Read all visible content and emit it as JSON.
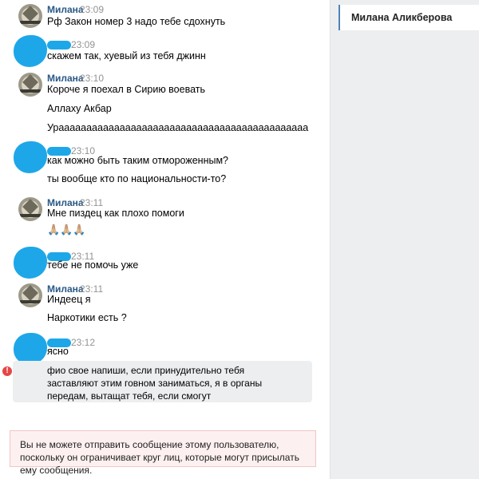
{
  "sidebar": {
    "conversation_name": "Милана Аликберова"
  },
  "messages": [
    {
      "sender": "Милана",
      "time": "23:09",
      "lines": [
        "Рф Закон номер 3 надо тебе сдохнуть"
      ]
    },
    {
      "sender": "",
      "time": "23:09",
      "lines": [
        "скажем так, хуевый из тебя джинн"
      ]
    },
    {
      "sender": "Милана",
      "time": "23:10",
      "lines": [
        "Короче я поехал в Сирию воевать",
        "Аллаху Акбар",
        "Урааааааааааааааааааааааааааааааааааааааааааааа"
      ]
    },
    {
      "sender": "",
      "time": "23:10",
      "lines": [
        "как можно быть таким отмороженным?",
        "ты вообще кто по национальности-то?"
      ]
    },
    {
      "sender": "Милана",
      "time": "23:11",
      "lines": [
        "Мне пиздец как плохо помоги",
        "🙏🏼🙏🏼🙏🏼"
      ]
    },
    {
      "sender": "",
      "time": "23:11",
      "lines": [
        "тебе не помочь уже"
      ]
    },
    {
      "sender": "Милана",
      "time": "23:11",
      "lines": [
        "Индеец я",
        "Наркотики есть ?"
      ]
    },
    {
      "sender": "",
      "time": "23:12",
      "lines": [
        "ясно"
      ]
    }
  ],
  "failed_message": {
    "icon": "!",
    "text": "фио свое напиши, если принудительно тебя заставляют этим говном заниматься, я в органы передам, вытащат тебя, если смогут"
  },
  "warning": "Вы не можете отправить сообщение этому пользователю, поскольку он ограничивает круг лиц, которые могут присылать ему сообщения."
}
